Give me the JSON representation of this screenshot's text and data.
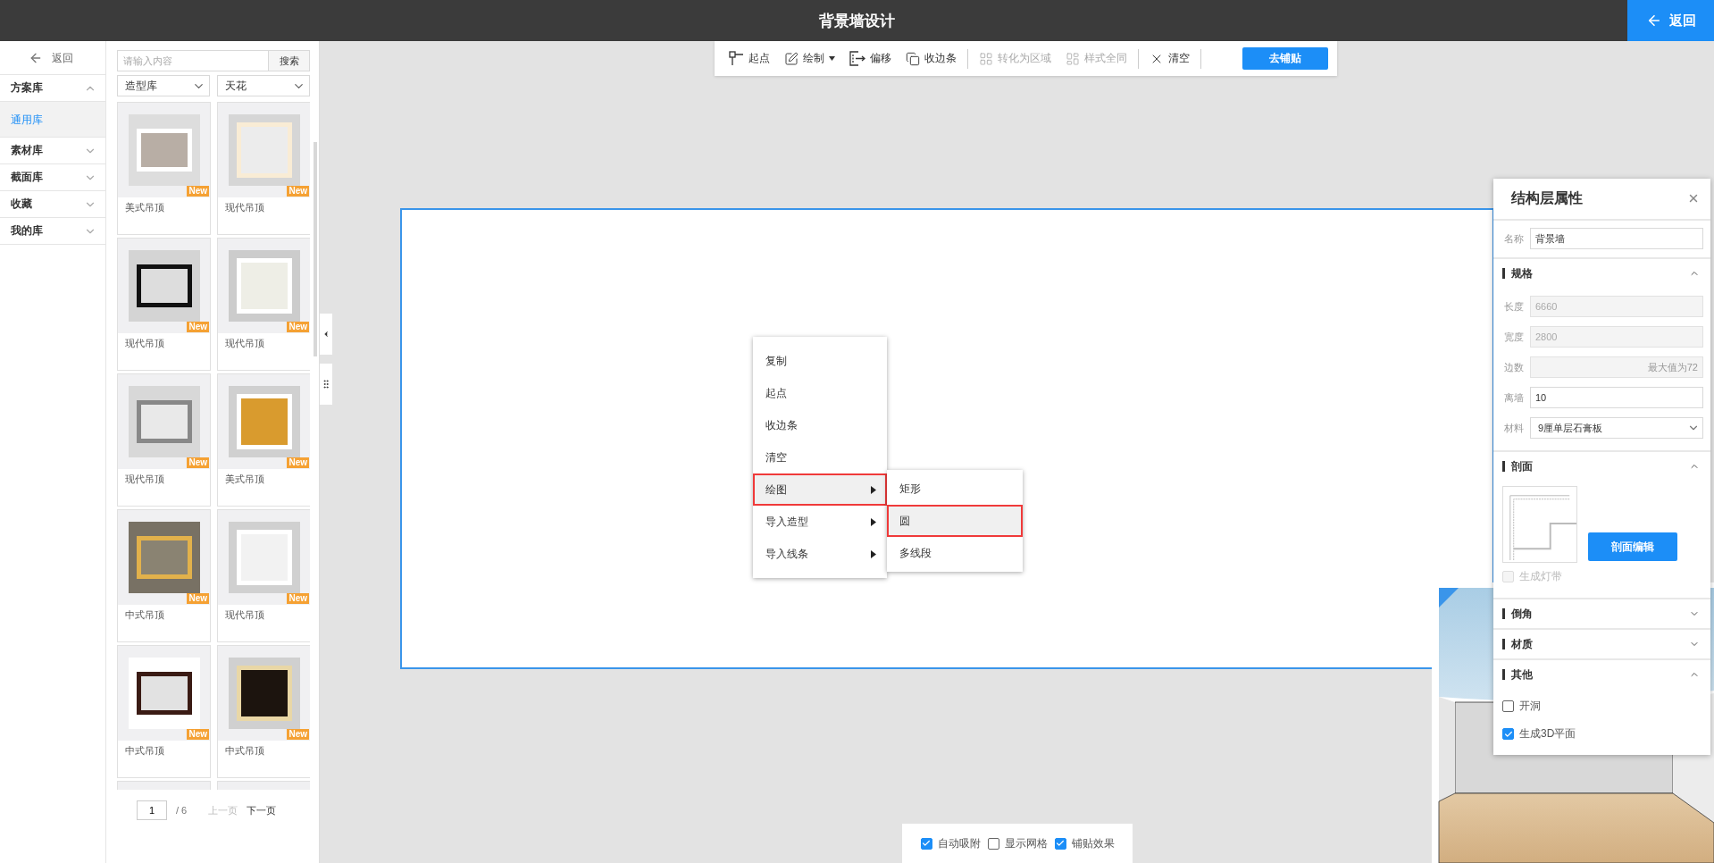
{
  "header": {
    "title": "背景墙设计",
    "back_button": "返回"
  },
  "sidebar": {
    "back_link": "返回",
    "categories": [
      {
        "label": "方案库",
        "expanded": true,
        "children": [
          {
            "label": "通用库",
            "selected": true
          }
        ]
      },
      {
        "label": "素材库",
        "expanded": false
      },
      {
        "label": "截面库",
        "expanded": false
      },
      {
        "label": "收藏",
        "expanded": false
      },
      {
        "label": "我的库",
        "expanded": false
      }
    ]
  },
  "library": {
    "search": {
      "placeholder": "请输入内容",
      "button": "搜索"
    },
    "filters": [
      {
        "value": "造型库"
      },
      {
        "value": "天花"
      }
    ],
    "items": [
      {
        "kind": "full",
        "label": "美式吊顶",
        "badge": "New"
      },
      {
        "kind": "full",
        "label": "现代吊顶",
        "badge": "New"
      },
      {
        "kind": "full",
        "label": "现代吊顶",
        "badge": "New"
      },
      {
        "kind": "full",
        "label": "现代吊顶",
        "badge": "New"
      },
      {
        "kind": "full",
        "label": "现代吊顶",
        "badge": "New"
      },
      {
        "kind": "full",
        "label": "美式吊顶",
        "badge": "New"
      },
      {
        "kind": "full",
        "label": "中式吊顶",
        "badge": "New"
      },
      {
        "kind": "full",
        "label": "现代吊顶",
        "badge": "New"
      },
      {
        "kind": "full",
        "label": "中式吊顶",
        "badge": "New"
      },
      {
        "kind": "full",
        "label": "中式吊顶",
        "badge": "New"
      },
      {
        "kind": "partial"
      },
      {
        "kind": "partial"
      }
    ],
    "pagination": {
      "page": "1",
      "total": "/ 6",
      "prev": "上一页",
      "next": "下一页",
      "prev_disabled": true
    }
  },
  "toolbar": {
    "tools": [
      {
        "label": "起点",
        "disabled": false,
        "dropdown": false
      },
      {
        "label": "绘制",
        "disabled": false,
        "dropdown": true
      },
      {
        "label": "偏移",
        "disabled": false,
        "dropdown": false
      },
      {
        "label": "收边条",
        "disabled": false,
        "dropdown": false
      },
      {
        "label": "转化为区域",
        "disabled": true,
        "dropdown": false
      },
      {
        "label": "样式全同",
        "disabled": true,
        "dropdown": false
      },
      {
        "label": "清空",
        "disabled": false,
        "dropdown": false
      }
    ],
    "primary": "去铺贴"
  },
  "context_menu": {
    "items": [
      {
        "label": "复制",
        "submenu": false,
        "selected": false
      },
      {
        "label": "起点",
        "submenu": false,
        "selected": false
      },
      {
        "label": "收边条",
        "submenu": false,
        "selected": false
      },
      {
        "label": "清空",
        "submenu": false,
        "selected": false
      },
      {
        "label": "绘图",
        "submenu": true,
        "selected": true
      },
      {
        "label": "导入造型",
        "submenu": true,
        "selected": false
      },
      {
        "label": "导入线条",
        "submenu": true,
        "selected": false
      }
    ],
    "submenu": {
      "items": [
        {
          "label": "矩形",
          "selected": false
        },
        {
          "label": "圆",
          "selected": true
        },
        {
          "label": "多线段",
          "selected": false
        }
      ]
    }
  },
  "bottom_bar": {
    "options": [
      {
        "label": "自动吸附",
        "checked": true
      },
      {
        "label": "显示网格",
        "checked": false
      },
      {
        "label": "铺贴效果",
        "checked": true
      }
    ]
  },
  "properties": {
    "title": "结构层属性",
    "name_field": {
      "label": "名称",
      "value": "背景墙"
    },
    "sections": [
      {
        "kind": "fields",
        "title": "规格",
        "expanded": true,
        "fields": [
          {
            "kind": "input",
            "label": "长度",
            "value": "6660",
            "disabled": true
          },
          {
            "kind": "input",
            "label": "宽度",
            "value": "2800",
            "disabled": true
          },
          {
            "kind": "input",
            "label": "边数",
            "placeholder": "最大值为72",
            "disabled": true
          },
          {
            "kind": "input",
            "label": "离墙",
            "value": "10",
            "disabled": false
          },
          {
            "kind": "select",
            "label": "材料",
            "value": "9厘单层石膏板"
          }
        ]
      },
      {
        "kind": "profile",
        "title": "剖面",
        "expanded": true,
        "button": "剖面编辑",
        "checks": [
          {
            "label": "生成灯带",
            "checked": false,
            "disabled": true
          }
        ]
      },
      {
        "title": "倒角",
        "expanded": false
      },
      {
        "title": "材质",
        "expanded": false
      },
      {
        "kind": "checks",
        "title": "其他",
        "expanded": true,
        "checks": [
          {
            "label": "开洞",
            "checked": false,
            "disabled": false
          },
          {
            "label": "生成3D平面",
            "checked": true,
            "disabled": false
          }
        ]
      }
    ]
  }
}
